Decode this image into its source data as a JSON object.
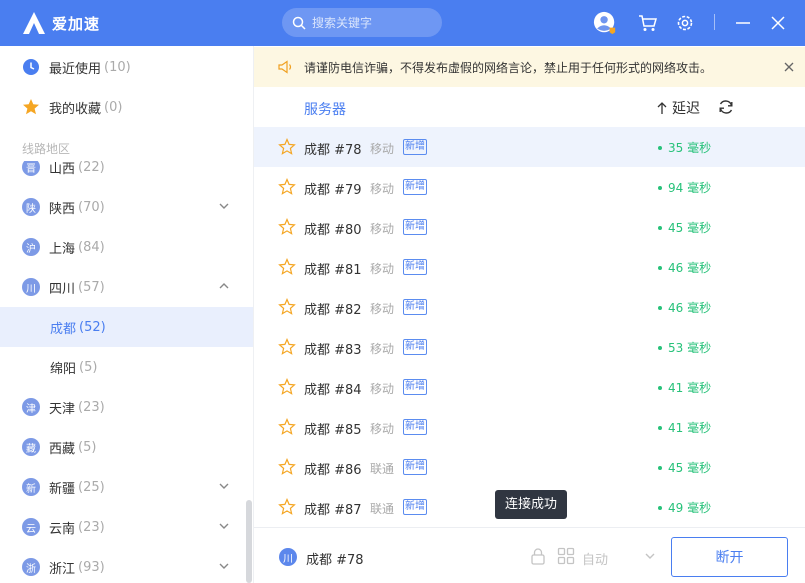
{
  "app": {
    "name": "爱加速"
  },
  "search": {
    "placeholder": "搜索关键字"
  },
  "colors": {
    "primary": "#4a7ef0",
    "latency_good": "#27c27a",
    "notice_bg": "#fdf7e2",
    "star": "#f5a623"
  },
  "sidebar": {
    "recent": {
      "label": "最近使用",
      "count": "(10)"
    },
    "favorites": {
      "label": "我的收藏",
      "count": "(0)"
    },
    "section_label": "线路地区",
    "regions": [
      {
        "badge": "晋",
        "label": "山西",
        "count": "(22)"
      },
      {
        "badge": "陕",
        "label": "陕西",
        "count": "(70)"
      },
      {
        "badge": "沪",
        "label": "上海",
        "count": "(84)"
      },
      {
        "badge": "川",
        "label": "四川",
        "count": "(57)"
      },
      {
        "label": "成都",
        "count": "(52)"
      },
      {
        "label": "绵阳",
        "count": "(5)"
      },
      {
        "badge": "津",
        "label": "天津",
        "count": "(23)"
      },
      {
        "badge": "藏",
        "label": "西藏",
        "count": "(5)"
      },
      {
        "badge": "新",
        "label": "新疆",
        "count": "(25)"
      },
      {
        "badge": "云",
        "label": "云南",
        "count": "(23)"
      },
      {
        "badge": "浙",
        "label": "浙江",
        "count": "(93)"
      }
    ]
  },
  "notice": {
    "text": "请谨防电信诈骗，不得发布虚假的网络言论，禁止用于任何形式的网络攻击。"
  },
  "server_list": {
    "title": "服务器",
    "latency_header": "延迟",
    "rows": [
      {
        "name": "成都 #78",
        "isp": "移动",
        "tag": "新增",
        "latency": "35 毫秒"
      },
      {
        "name": "成都 #79",
        "isp": "移动",
        "tag": "新增",
        "latency": "94 毫秒"
      },
      {
        "name": "成都 #80",
        "isp": "移动",
        "tag": "新增",
        "latency": "45 毫秒"
      },
      {
        "name": "成都 #81",
        "isp": "移动",
        "tag": "新增",
        "latency": "46 毫秒"
      },
      {
        "name": "成都 #82",
        "isp": "移动",
        "tag": "新增",
        "latency": "46 毫秒"
      },
      {
        "name": "成都 #83",
        "isp": "移动",
        "tag": "新增",
        "latency": "53 毫秒"
      },
      {
        "name": "成都 #84",
        "isp": "移动",
        "tag": "新增",
        "latency": "41 毫秒"
      },
      {
        "name": "成都 #85",
        "isp": "移动",
        "tag": "新增",
        "latency": "41 毫秒"
      },
      {
        "name": "成都 #86",
        "isp": "联通",
        "tag": "新增",
        "latency": "45 毫秒"
      },
      {
        "name": "成都 #87",
        "isp": "联通",
        "tag": "新增",
        "latency": "49 毫秒"
      }
    ]
  },
  "toast": {
    "text": "连接成功"
  },
  "footer": {
    "badge": "川",
    "server": "成都 #78",
    "mode": "自动",
    "disconnect_label": "断开"
  }
}
